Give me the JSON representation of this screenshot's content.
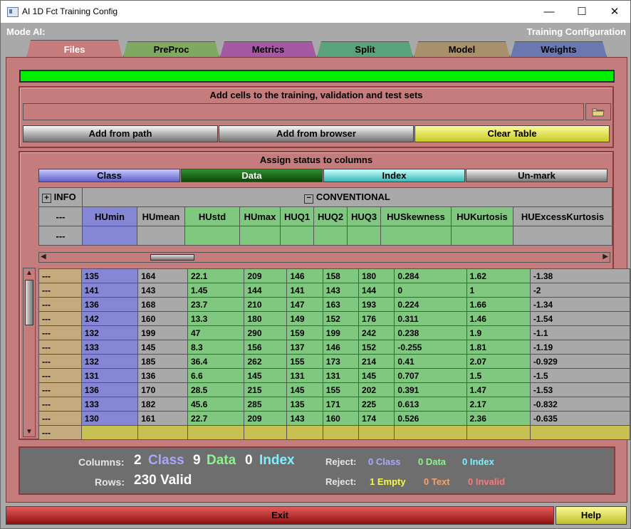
{
  "window": {
    "title": "AI 1D Fct Training Config",
    "minimize": "—",
    "maximize": "☐",
    "close": "✕"
  },
  "header": {
    "mode": "Mode AI:",
    "section": "Training Configuration"
  },
  "tabs": [
    {
      "label": "Files",
      "color": "#c57c7c",
      "active": true
    },
    {
      "label": "PreProc",
      "color": "#7fa860"
    },
    {
      "label": "Metrics",
      "color": "#a35aa3"
    },
    {
      "label": "Split",
      "color": "#5aa37a"
    },
    {
      "label": "Model",
      "color": "#a8906a"
    },
    {
      "label": "Weights",
      "color": "#6a78b0"
    }
  ],
  "progress": {
    "value": 1.0,
    "color": "#00ee00"
  },
  "add_section": {
    "title": "Add cells to the training, validation and test sets",
    "path_value": "",
    "folder_icon": "folder-icon",
    "buttons": {
      "add_path": "Add from path",
      "add_browser": "Add from browser",
      "clear": "Clear Table"
    }
  },
  "assign_section": {
    "title": "Assign status to columns",
    "buttons": {
      "class": "Class",
      "data": "Data",
      "index": "Index",
      "unmark": "Un-mark"
    }
  },
  "table": {
    "groups": {
      "info_toggle": "+",
      "info": "INFO",
      "conv_toggle": "−",
      "conventional": "CONVENTIONAL"
    },
    "info_header": "---",
    "info_status": "---",
    "columns": [
      "HUmin",
      "HUmean",
      "HUstd",
      "HUmax",
      "HUQ1",
      "HUQ2",
      "HUQ3",
      "HUSkewness",
      "HUKurtosis",
      "HUExcessKurtosis"
    ],
    "rows": [
      [
        "---",
        "135",
        "164",
        "22.1",
        "209",
        "146",
        "158",
        "180",
        "0.284",
        "1.62",
        "-1.38"
      ],
      [
        "---",
        "141",
        "143",
        "1.45",
        "144",
        "141",
        "143",
        "144",
        "0",
        "1",
        "-2"
      ],
      [
        "---",
        "136",
        "168",
        "23.7",
        "210",
        "147",
        "163",
        "193",
        "0.224",
        "1.66",
        "-1.34"
      ],
      [
        "---",
        "142",
        "160",
        "13.3",
        "180",
        "149",
        "152",
        "176",
        "0.311",
        "1.46",
        "-1.54"
      ],
      [
        "---",
        "132",
        "199",
        "47",
        "290",
        "159",
        "199",
        "242",
        "0.238",
        "1.9",
        "-1.1"
      ],
      [
        "---",
        "133",
        "145",
        "8.3",
        "156",
        "137",
        "146",
        "152",
        "-0.255",
        "1.81",
        "-1.19"
      ],
      [
        "---",
        "132",
        "185",
        "36.4",
        "262",
        "155",
        "173",
        "214",
        "0.41",
        "2.07",
        "-0.929"
      ],
      [
        "---",
        "131",
        "136",
        "6.6",
        "145",
        "131",
        "131",
        "145",
        "0.707",
        "1.5",
        "-1.5"
      ],
      [
        "---",
        "136",
        "170",
        "28.5",
        "215",
        "145",
        "155",
        "202",
        "0.391",
        "1.47",
        "-1.53"
      ],
      [
        "---",
        "133",
        "182",
        "45.6",
        "285",
        "135",
        "171",
        "225",
        "0.613",
        "2.17",
        "-0.832"
      ],
      [
        "---",
        "130",
        "161",
        "22.7",
        "209",
        "143",
        "160",
        "174",
        "0.526",
        "2.36",
        "-0.635"
      ],
      [
        "---",
        "",
        "",
        "",
        "",
        "",
        "",
        "",
        "",
        "",
        ""
      ]
    ]
  },
  "summary": {
    "columns_label": "Columns:",
    "class_count": "2",
    "class_label": "Class",
    "data_count": "9",
    "data_label": "Data",
    "index_count": "0",
    "index_label": "Index",
    "rows_label": "Rows:",
    "rows_value": "230 Valid",
    "reject_label_1": "Reject:",
    "reject_class": "0 Class",
    "reject_data": "0 Data",
    "reject_index": "0 Index",
    "reject_label_2": "Reject:",
    "reject_empty": "1 Empty",
    "reject_text": "0 Text",
    "reject_invalid": "0 Invalid"
  },
  "footer": {
    "exit": "Exit",
    "help": "Help"
  },
  "colors": {
    "panel": "#c57c7c",
    "class": "#8686d6",
    "data": "#80c880",
    "index": "#7fe0e0",
    "unmarked": "#a9a9a9",
    "info": "#c4aa7c",
    "empty_row": "#c8c050"
  }
}
